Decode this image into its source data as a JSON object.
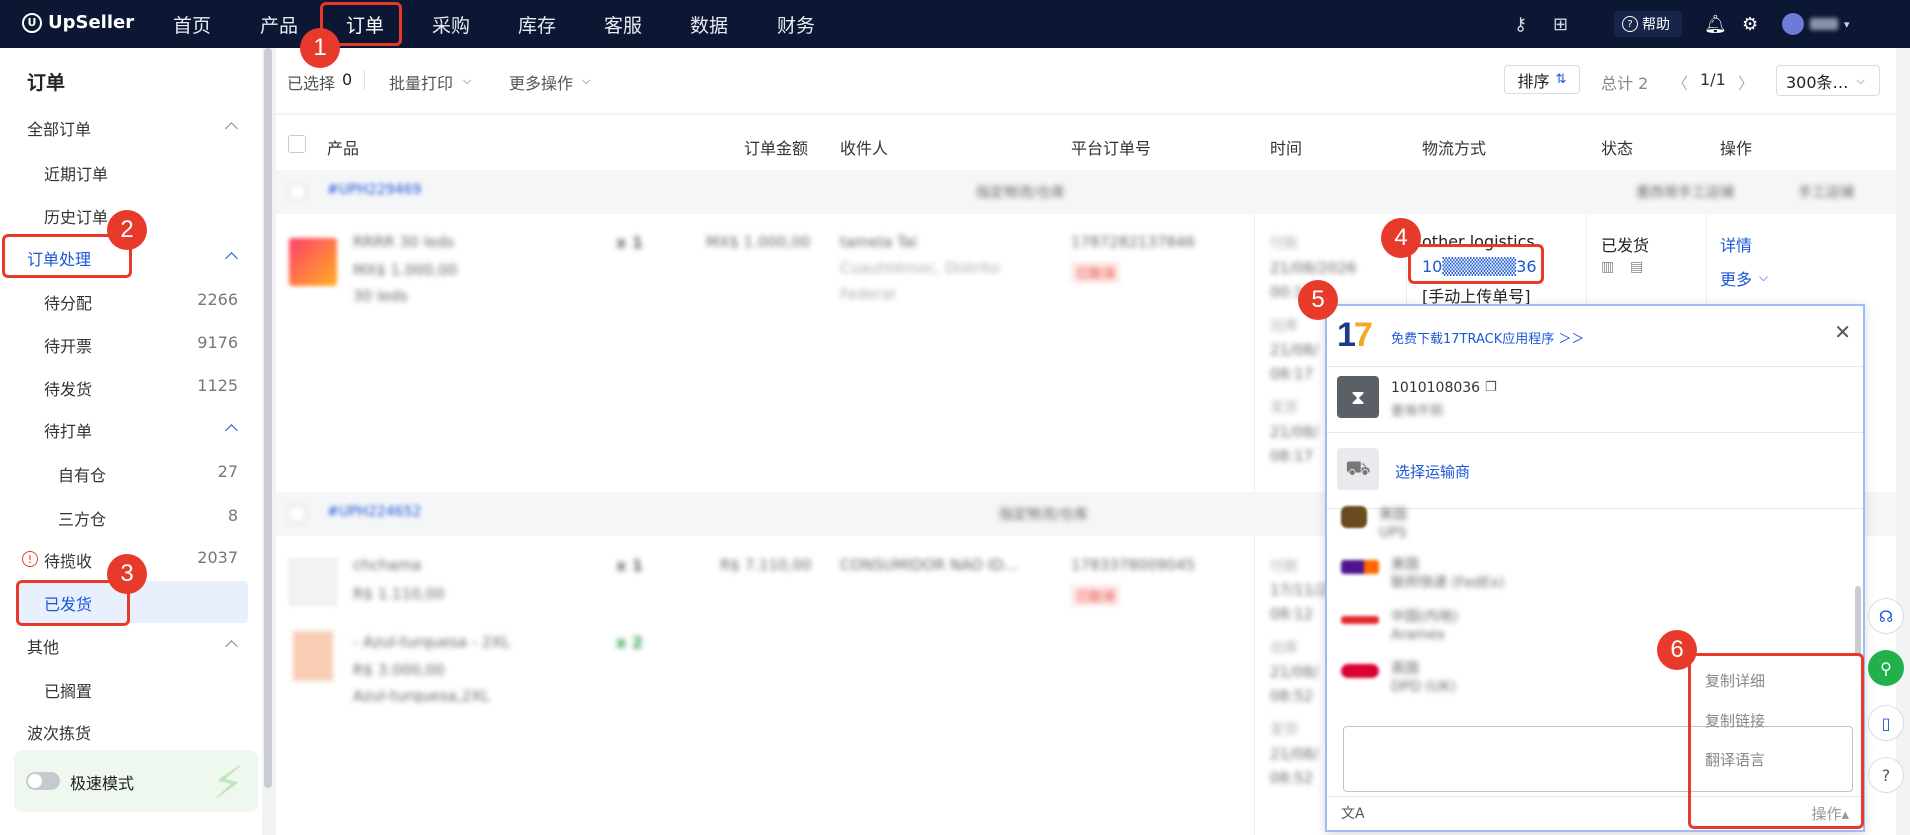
{
  "app": {
    "logo": "UpSeller"
  },
  "nav": {
    "items": [
      "首页",
      "产品",
      "订单",
      "采购",
      "库存",
      "客服",
      "数据",
      "财务"
    ],
    "active": "订单",
    "help": "帮助"
  },
  "annotations": [
    "1",
    "2",
    "3",
    "4",
    "5",
    "6"
  ],
  "sidebar": {
    "title": "订单",
    "all_orders": "全部订单",
    "recent": "近期订单",
    "history": "历史订单",
    "processing": "订单处理",
    "to_assign": {
      "label": "待分配",
      "count": "2266"
    },
    "to_invoice": {
      "label": "待开票",
      "count": "9176"
    },
    "to_ship": {
      "label": "待发货",
      "count": "1125"
    },
    "to_print": "待打单",
    "own_wh": {
      "label": "自有仓",
      "count": "27"
    },
    "third_wh": {
      "label": "三方仓",
      "count": "8"
    },
    "to_collect": {
      "label": "待揽收",
      "count": "2037"
    },
    "shipped": "已发货",
    "other": "其他",
    "shelved": "已搁置",
    "wave_pick": "波次拣货",
    "speed_mode": "极速模式"
  },
  "toolbar": {
    "selected_prefix": "已选择",
    "selected_count": "0",
    "batch_print": "批量打印",
    "more_ops": "更多操作",
    "sort": "排序",
    "total": "总计 2",
    "pager": "1/1",
    "page_size": "300条…"
  },
  "table": {
    "headers": [
      "产品",
      "订单金额",
      "收件人",
      "平台订单号",
      "时间",
      "物流方式",
      "状态",
      "操作"
    ],
    "groups": [
      {
        "order_no": "#UPH229469",
        "center": "指定物流/仓库",
        "right1": "墨西哥手工店铺",
        "right2": "手工店铺"
      },
      {
        "order_no": "#UPH224652",
        "center": "指定物流/仓库"
      }
    ],
    "row1": {
      "product_name": "RRRR 30 leds",
      "product_price": "MX$ 1.000,00",
      "product_variant": "30 leds",
      "qty": "x 1",
      "amount": "MX$ 1.000,00",
      "recipient": "tamela Tai",
      "address1": "Cuauhtémoc, Distrito",
      "address2": "Federal",
      "platform_no": "1787282137846",
      "platform_tag": "已取消",
      "time_label1": "付款",
      "time1": "21/08/2026",
      "time1b": "00:1",
      "time_label2": "出库",
      "time2": "21/08/",
      "time2b": "08:17",
      "time_label3": "发货",
      "time3": "21/08/",
      "time3b": "08:17",
      "logistics": "other logistics",
      "tracking": "10▒▒▒▒▒▒36",
      "manual_upload": "[手动上传单号]",
      "status": "已发货",
      "action_detail": "详情",
      "action_more": "更多"
    },
    "row2": {
      "product1_name": "chchama",
      "product1_price": "R$ 1.110,00",
      "product1_qty": "x 1",
      "product2_name": "- Azul-turquesa - 2XL",
      "product2_price": "R$ 3.000,00",
      "product2_variant": "Azul-turquesa,2XL",
      "product2_qty": "x 2",
      "amount": "R$ 7.110,00",
      "recipient": "CONSUMIDOR NAO ID...",
      "platform_no": "1783378009045",
      "platform_tag": "已取消",
      "time_label1": "付款",
      "time1": "17/11/2",
      "time1b": "08:12",
      "time_label2": "出库",
      "time2": "21/08/",
      "time2b": "08:52",
      "time_label3": "发货",
      "time3": "21/08/",
      "time3b": "08:52"
    }
  },
  "popup": {
    "download": "免费下载17TRACK应用程序 ＞＞",
    "tracking": "1010108036",
    "status": "查询不到",
    "choose_carrier": "选择运输商",
    "carriers": [
      {
        "name": "美国",
        "sub": "UPS",
        "color": "#6b4a1e"
      },
      {
        "name": "美国",
        "sub": "联邦快递 (FedEx)",
        "color": "#4d148c"
      },
      {
        "name": "中国(内地)",
        "sub": "Aramex",
        "color": "#e3262c"
      },
      {
        "name": "英国",
        "sub": "DPD (UK)",
        "color": "#dc0032"
      }
    ],
    "menu": [
      "复制详细",
      "复制链接",
      "翻译语言"
    ],
    "op": "操作"
  }
}
